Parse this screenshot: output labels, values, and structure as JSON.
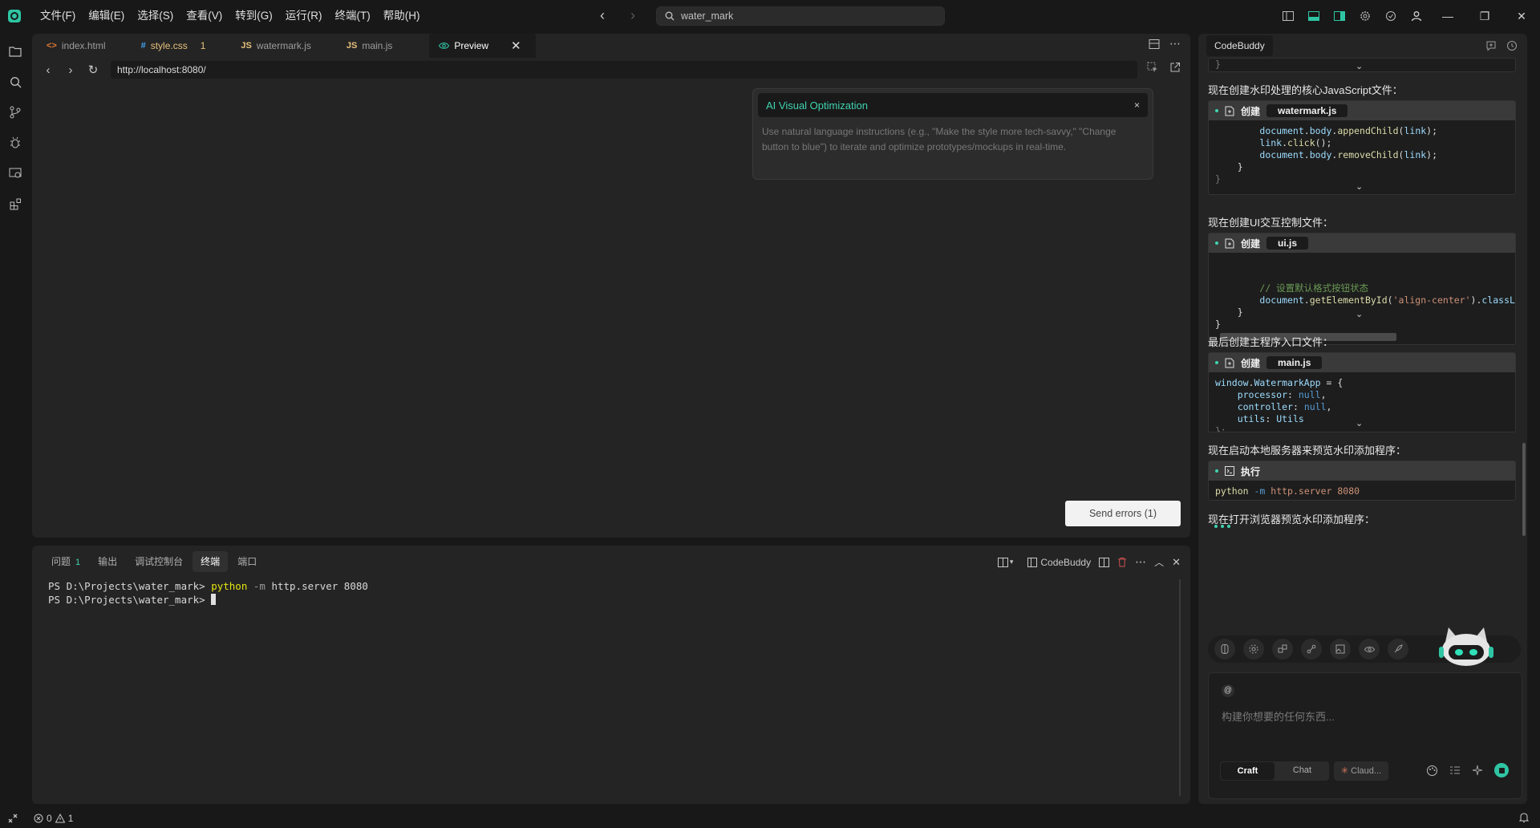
{
  "titlebar": {
    "menus": [
      "文件(F)",
      "编辑(E)",
      "选择(S)",
      "查看(V)",
      "转到(G)",
      "运行(R)",
      "终端(T)",
      "帮助(H)"
    ],
    "search": "water_mark"
  },
  "editor": {
    "tabs": [
      {
        "icon": "<>",
        "label": "index.html"
      },
      {
        "icon": "#",
        "label": "style.css",
        "badge": "1"
      },
      {
        "icon": "JS",
        "label": "watermark.js"
      },
      {
        "icon": "JS",
        "label": "main.js"
      },
      {
        "icon": "eye",
        "label": "Preview"
      }
    ],
    "url": "http://localhost:8080/",
    "ai_popup": {
      "title": "AI Visual Optimization",
      "close": "×",
      "body": "Use natural language instructions (e.g., \"Make the style more tech-savvy,\" \"Change button to blue\") to iterate and optimize prototypes/mockups in real-time."
    },
    "send_errors": "Send errors (1)"
  },
  "panel": {
    "tabs": [
      {
        "label": "问题",
        "count": "1"
      },
      {
        "label": "输出"
      },
      {
        "label": "调试控制台"
      },
      {
        "label": "终端"
      },
      {
        "label": "端口"
      }
    ],
    "codebuddy_label": "CodeBuddy",
    "terminal": {
      "prompt": "PS D:\\Projects\\water_mark>",
      "cmd": "python",
      "flag": "-m",
      "args": "http.server 8080"
    }
  },
  "statusbar": {
    "errors": "0",
    "warnings": "1"
  },
  "sidebar": {
    "tab": "CodeBuddy",
    "messages": {
      "m1": "现在创建水印处理的核心JavaScript文件：",
      "m2": "现在创建UI交互控制文件：",
      "m3": "最后创建主程序入口文件：",
      "m4": "现在启动本地服务器来预览水印添加程序：",
      "m5": "现在打开浏览器预览水印添加程序："
    },
    "blocks": {
      "create_label": "创建",
      "run_label": "执行",
      "b0_tail": "}",
      "b1": {
        "file": "watermark.js",
        "l1a": "document",
        "l1b": "body",
        "l1c": "appendChild",
        "l1d": "link",
        "l2a": "link",
        "l2b": "click",
        "l3a": "document",
        "l3b": "body",
        "l3c": "removeChild",
        "l3d": "link"
      },
      "b2": {
        "file": "ui.js",
        "comment": "// 设置默认格式按钮状态",
        "l2a": "document",
        "l2b": "getElementById",
        "l2c": "'align-center'",
        "l2d": "classList"
      },
      "b3": {
        "file": "main.js",
        "l1a": "window",
        "l1b": "WatermarkApp",
        "p1": "processor",
        "p2": "controller",
        "p3": "utils",
        "null": "null",
        "utils_val": "Utils"
      },
      "b4": {
        "cmd": "python",
        "flag": "-m",
        "args": "http.server 8080"
      }
    },
    "input": {
      "at": "@",
      "placeholder": "构建你想要的任何东西...",
      "modes": [
        "Craft",
        "Chat"
      ],
      "model": "Claud..."
    }
  }
}
